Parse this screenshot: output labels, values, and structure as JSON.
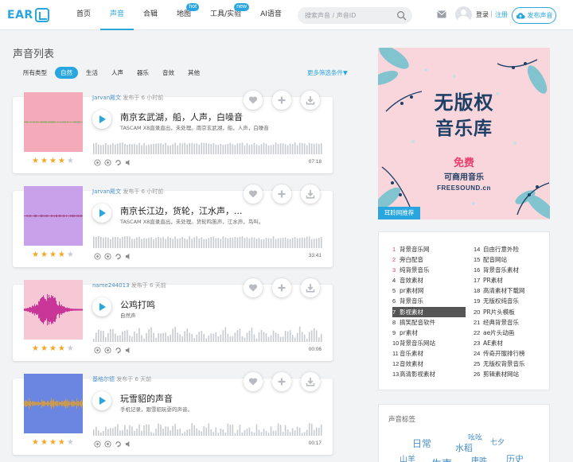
{
  "header": {
    "logo_text": "EAR",
    "nav": [
      {
        "label": "首页",
        "badge": ""
      },
      {
        "label": "声音",
        "badge": ""
      },
      {
        "label": "合辑",
        "badge": ""
      },
      {
        "label": "地图",
        "badge": "hot"
      },
      {
        "label": "工具/实验",
        "badge": "new"
      },
      {
        "label": "AI语音",
        "badge": ""
      }
    ],
    "search_placeholder": "搜索声音 / 声音ID",
    "login": "登录",
    "separator": "|",
    "register": "注册",
    "publish": "发布声音"
  },
  "main": {
    "title": "声音列表",
    "filters": [
      "所有类型",
      "自然",
      "生活",
      "人声",
      "器乐",
      "音效",
      "其他"
    ],
    "active_filter": "自然",
    "more_filters": "更多筛选条件▼",
    "cards": [
      {
        "author": "Jarvan殿文",
        "time": "发布于 6 小时前",
        "title": "南京玄武湖，船，人声，白噪音",
        "desc": "TASCAM X8直录直出，未处理。南京玄武湖，船，人声，白噪音",
        "duration": "07:18",
        "rating": 4,
        "thumb_color": "#f4aab9",
        "wave_color": "#7fa35a"
      },
      {
        "author": "Jarvan殿文",
        "time": "发布于 6 小时前",
        "title": "南京长江边，货轮，江水声，...",
        "desc": "TASCAM X8直录直出，未处理。货轮鸣笛声，江水声，鸟叫。",
        "duration": "33:41",
        "rating": 4,
        "thumb_color": "#c9a0ea",
        "wave_color": "#a0407a"
      },
      {
        "author": "name244013",
        "time": "发布于 6 天前",
        "title": "公鸡打鸣",
        "desc": "自然声",
        "duration": "00:06",
        "rating": 4,
        "thumb_color": "#f6c7d4",
        "wave_color": "#c0148a"
      },
      {
        "author": "基格尔德",
        "time": "发布于 6 天前",
        "title": "玩雪貂的声音",
        "desc": "手机记录，跟雪貂玩耍的声音。",
        "duration": "00:17",
        "rating": 4,
        "thumb_color": "#6b86e0",
        "wave_color": "#e0a030"
      }
    ]
  },
  "ad": {
    "line1": "无版权",
    "line2": "音乐库",
    "free": "免费",
    "sub": "可商用音乐",
    "site": "FREESOUND.cn",
    "tag": "耳聆网推荐"
  },
  "ranking": {
    "left": [
      {
        "num": "1",
        "label": "背景音乐网"
      },
      {
        "num": "2",
        "label": "旁白配音"
      },
      {
        "num": "3",
        "label": "纯背景音乐"
      },
      {
        "num": "4",
        "label": "音效素材"
      },
      {
        "num": "5",
        "label": "pr素材网"
      },
      {
        "num": "6",
        "label": "背景音乐"
      },
      {
        "num": "7",
        "label": "影视素材"
      },
      {
        "num": "8",
        "label": "搞笑配音软件"
      },
      {
        "num": "9",
        "label": "pr素材"
      },
      {
        "num": "10",
        "label": "背景音乐网站"
      },
      {
        "num": "11",
        "label": "音乐素材"
      },
      {
        "num": "12",
        "label": "音效素材"
      },
      {
        "num": "13",
        "label": "高清影视素材"
      }
    ],
    "right": [
      {
        "num": "14",
        "label": "自由行意外险"
      },
      {
        "num": "15",
        "label": "配音网站"
      },
      {
        "num": "16",
        "label": "背景音乐素材"
      },
      {
        "num": "17",
        "label": "PR素材"
      },
      {
        "num": "18",
        "label": "高清素材下载网"
      },
      {
        "num": "19",
        "label": "无版权纯音乐"
      },
      {
        "num": "20",
        "label": "PR片头模板"
      },
      {
        "num": "21",
        "label": "经典背景音乐"
      },
      {
        "num": "22",
        "label": "ae片头动画"
      },
      {
        "num": "23",
        "label": "AE素材"
      },
      {
        "num": "24",
        "label": "传奇开服排行榜"
      },
      {
        "num": "25",
        "label": "无版权背景音乐"
      },
      {
        "num": "26",
        "label": "剪辑素材网站"
      }
    ],
    "selected": "7"
  },
  "tags": {
    "title": "声音标签",
    "items": [
      "日常",
      "山羊",
      "生声",
      "水稻",
      "吆吆",
      "唐吽",
      "历史",
      "七夕"
    ]
  },
  "colors": {
    "accent": "#29a6df",
    "star": "#f5a623",
    "hot_rank": "#e8406a"
  }
}
